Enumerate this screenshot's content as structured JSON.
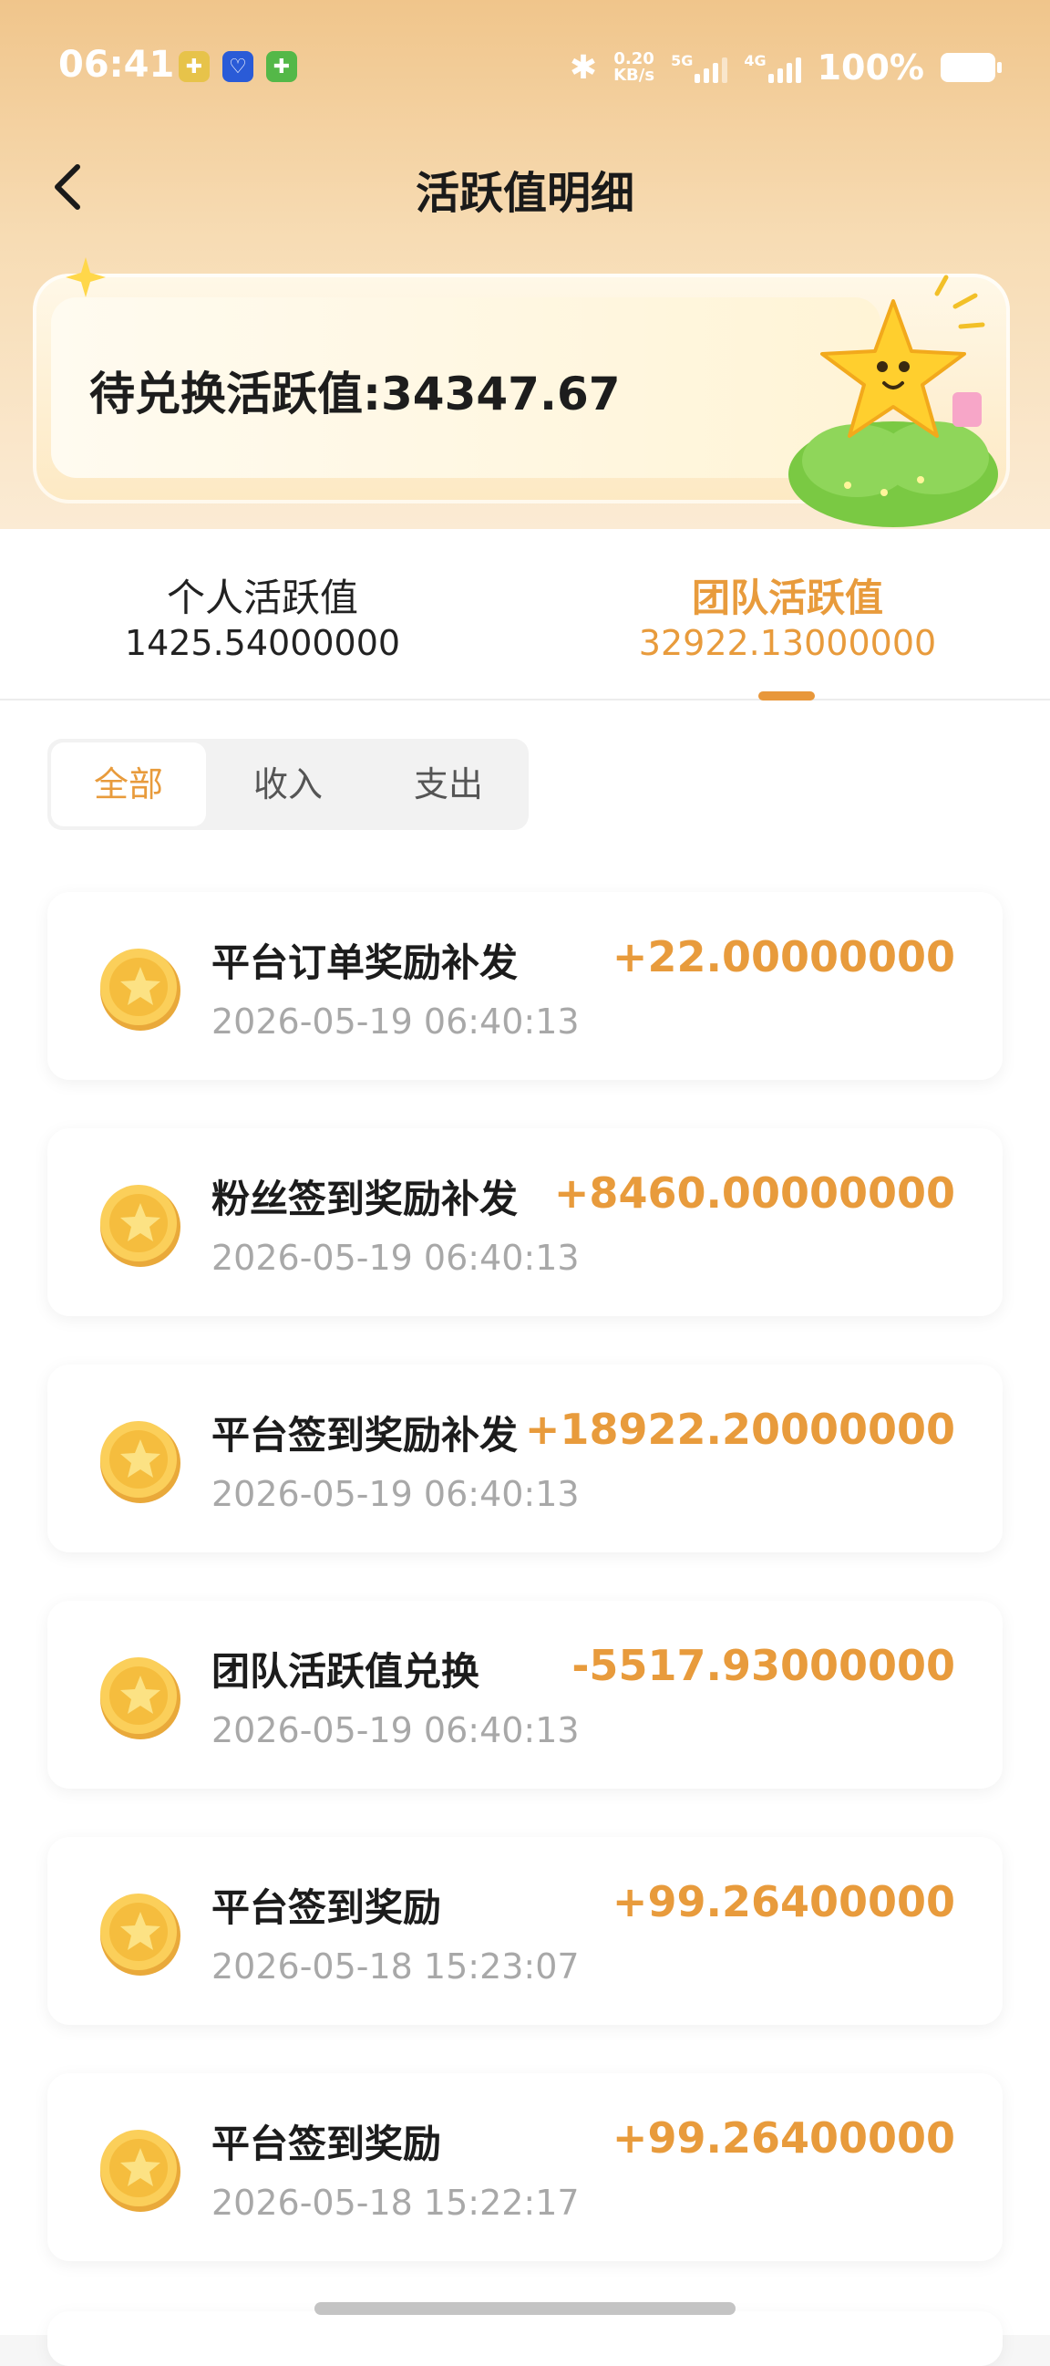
{
  "status_bar": {
    "time": "06:41",
    "net_speed_value": "0.20",
    "net_speed_unit": "KB/s",
    "network_5g": "5G",
    "network_4g": "4G",
    "battery_percent": "100%"
  },
  "header": {
    "title": "活跃值明细"
  },
  "banner": {
    "text": "待兑换活跃值:34347.67"
  },
  "tabs": [
    {
      "label": "个人活跃值",
      "value": "1425.54000000"
    },
    {
      "label": "团队活跃值",
      "value": "32922.13000000"
    }
  ],
  "filters": {
    "all": "全部",
    "income": "收入",
    "expense": "支出",
    "selected": "全部"
  },
  "records": [
    {
      "title": "平台订单奖励补发",
      "time": "2026-05-19 06:40:13",
      "amount": "+22.00000000"
    },
    {
      "title": "粉丝签到奖励补发",
      "time": "2026-05-19 06:40:13",
      "amount": "+8460.00000000"
    },
    {
      "title": "平台签到奖励补发",
      "time": "2026-05-19 06:40:13",
      "amount": "+18922.20000000"
    },
    {
      "title": "团队活跃值兑换",
      "time": "2026-05-19 06:40:13",
      "amount": "-5517.93000000"
    },
    {
      "title": "平台签到奖励",
      "time": "2026-05-18 15:23:07",
      "amount": "+99.26400000"
    },
    {
      "title": "平台签到奖励",
      "time": "2026-05-18 15:22:17",
      "amount": "+99.26400000"
    }
  ],
  "colors": {
    "accent": "#e89b3c",
    "header_gradient_top": "#f0c58b"
  }
}
